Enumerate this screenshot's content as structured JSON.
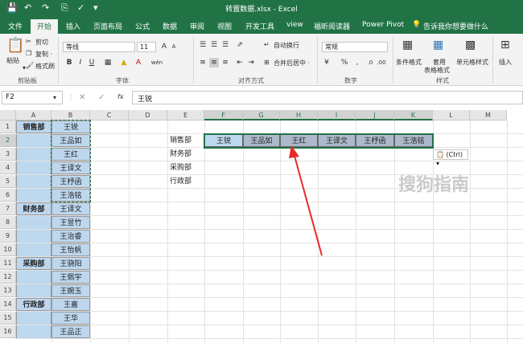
{
  "window": {
    "title": "转置数据.xlsx - Excel"
  },
  "tabs": [
    "文件",
    "开始",
    "插入",
    "页面布局",
    "公式",
    "数据",
    "审阅",
    "视图",
    "开发工具",
    "view",
    "福昕阅读器",
    "Power Pivot",
    "告诉我你想要做什么"
  ],
  "active_tab": "开始",
  "ribbon": {
    "clipboard": {
      "paste": "粘贴",
      "cut": "剪切",
      "copy": "复制 ·",
      "format_painter": "格式刷",
      "group": "剪贴板"
    },
    "font": {
      "name": "等线",
      "size": "11",
      "group": "字体",
      "bold": "B",
      "italic": "I",
      "underline": "U",
      "grow": "A",
      "shrink": "A",
      "wen": "wén"
    },
    "alignment": {
      "wrap": "自动换行",
      "merge": "合并后居中 ·",
      "group": "对齐方式"
    },
    "number": {
      "format": "常规",
      "percent": "%",
      "comma": ",",
      "group": "数字"
    },
    "styles": {
      "conditional": "条件格式",
      "table_line1": "套用",
      "table_line2": "表格格式",
      "cell_styles": "单元格样式",
      "group": "样式"
    },
    "cells": {
      "insert": "插入"
    }
  },
  "formula_bar": {
    "name_box": "F2",
    "fx": "fx",
    "value": "王锐"
  },
  "columns": [
    "A",
    "B",
    "C",
    "D",
    "E",
    "F",
    "G",
    "H",
    "I",
    "J",
    "K",
    "L",
    "M"
  ],
  "rows": [
    "1",
    "2",
    "3",
    "4",
    "5",
    "6",
    "7",
    "8",
    "9",
    "10",
    "11",
    "12",
    "13",
    "14",
    "15",
    "16"
  ],
  "sheet": {
    "a": [
      "销售部",
      "",
      "",
      "",
      "",
      "",
      "财务部",
      "",
      "",
      "",
      "采购部",
      "",
      "",
      "行政部",
      "",
      ""
    ],
    "b": [
      "王锐",
      "王品如",
      "王红",
      "王译文",
      "王杼函",
      "王浩铭",
      "王译文",
      "王昱竹",
      "王治睿",
      "王怡帆",
      "王骁阳",
      "王佩宇",
      "王婉玉",
      "王嘉",
      "王华",
      "王品正"
    ],
    "e": [
      "销售部",
      "财务部",
      "采购部",
      "行政部"
    ],
    "transposed": [
      "王锐",
      "王品如",
      "王红",
      "王译文",
      "王杼函",
      "王浩铭"
    ]
  },
  "paste_options": "(Ctrl) ▾",
  "watermark": "搜狗指南",
  "colors": {
    "excel_green": "#217346",
    "dept_fill": "#bdd7ee",
    "transposed_fill": "#acb9ca",
    "arrow": "#e8292b"
  }
}
